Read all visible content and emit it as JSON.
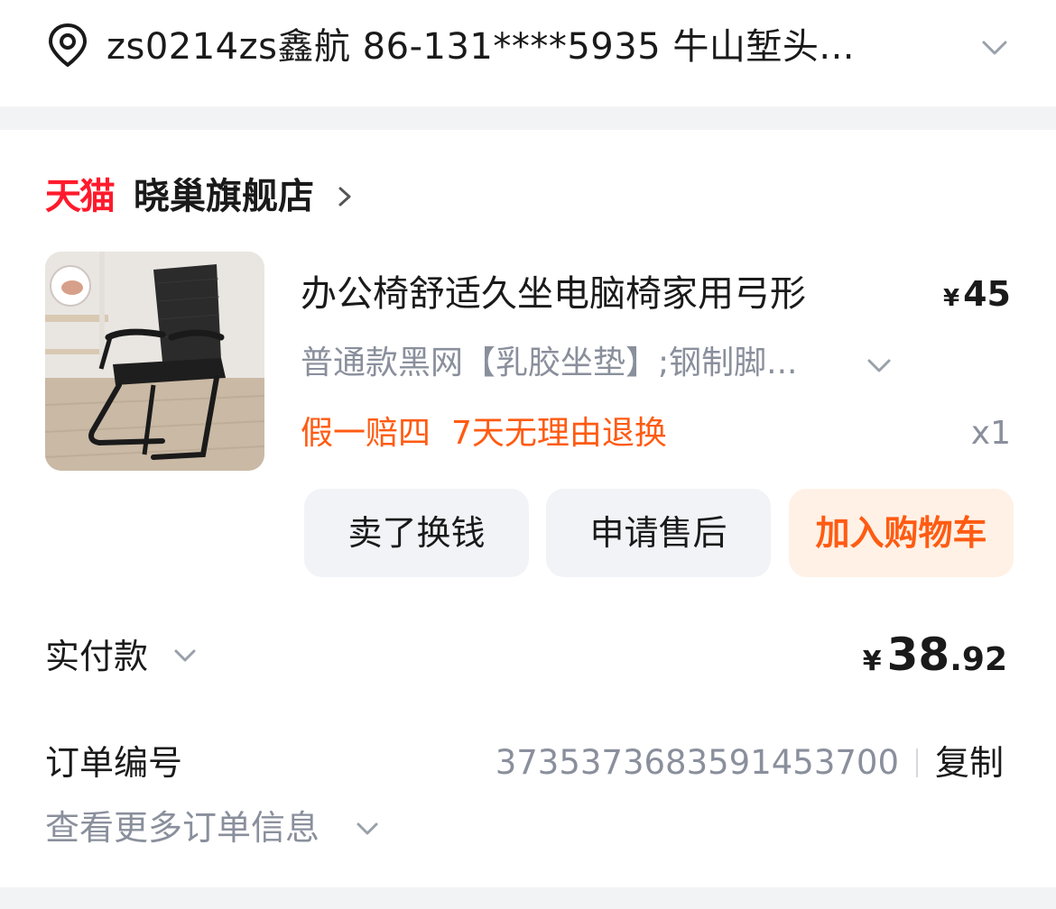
{
  "address": {
    "summary": "zs0214zs鑫航 86-131****5935 牛山堑头...",
    "icon": "location-pin-icon",
    "expand_icon": "chevron-down-icon"
  },
  "shop": {
    "platform_badge": "天猫",
    "name": "晓巢旗舰店",
    "badge_color": "#ff1a2c",
    "arrow_icon": "chevron-right-icon"
  },
  "product": {
    "image_icon": "office-chair-image",
    "title": "办公椅舒适久坐电脑椅家用弓形",
    "price_symbol": "¥",
    "price": "45",
    "sku": "普通款黑网【乳胶坐垫】;钢制脚...",
    "services": [
      "假一赔四",
      "7天无理由退换"
    ],
    "quantity": "x1",
    "service_color": "#ff5b12"
  },
  "actions": {
    "sell": "卖了换钱",
    "after_sales": "申请售后",
    "add_cart": "加入购物车"
  },
  "payment": {
    "label": "实付款",
    "symbol": "¥",
    "integer": "38",
    "decimal": ".92"
  },
  "order": {
    "label": "订单编号",
    "number": "3735373683591453700",
    "copy": "复制",
    "more": "查看更多订单信息"
  }
}
